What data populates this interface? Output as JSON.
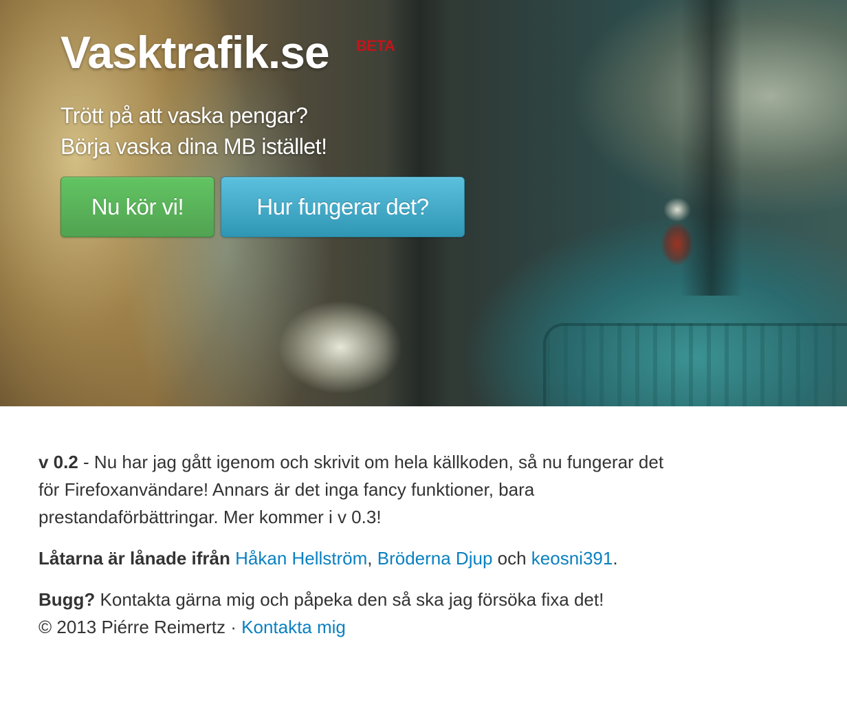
{
  "hero": {
    "logo": "Vasktrafik.se",
    "beta": "BETA",
    "tagline_line1": "Trött på att vaska pengar?",
    "tagline_line2": "Börja vaska dina MB istället!",
    "primary_button": "Nu kör vi!",
    "secondary_button": "Hur fungerar det?",
    "colors": {
      "primary_button": "#5bb75b",
      "secondary_button": "#49afcd",
      "beta": "#c0161b"
    }
  },
  "content": {
    "version_label": "v 0.2",
    "version_text": " - Nu har jag gått igenom och skrivit om hela källkoden, så nu fungerar det för Firefoxanvändare! Annars är det inga fancy funktioner, bara prestandaförbättringar. Mer kommer i v 0.3!",
    "songs_label": "Låtarna är lånade ifrån",
    "songs_links": [
      "Håkan Hellström",
      "Bröderna Djup",
      "keosni391"
    ],
    "songs_sep1": ", ",
    "songs_sep2": " och ",
    "songs_end": ".",
    "bug_label": "Bugg?",
    "bug_text": " Kontakta gärna mig och påpeka den så ska jag försöka fixa det!",
    "copyright": "© 2013 Piérre Reimertz · ",
    "contact_link": "Kontakta mig",
    "link_color": "#0a80c0"
  }
}
